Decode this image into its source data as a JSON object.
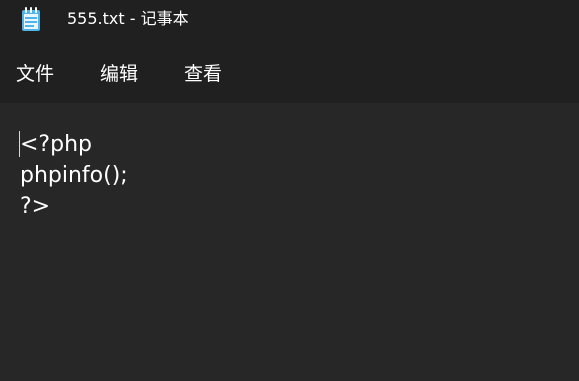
{
  "window": {
    "title": "555.txt - 记事本",
    "app_icon": "notepad-icon"
  },
  "menu": {
    "file_label": "文件",
    "edit_label": "编辑",
    "view_label": "查看"
  },
  "editor": {
    "lines": [
      "<?php",
      "phpinfo();",
      "?>"
    ]
  },
  "colors": {
    "titlebar_bg": "#202020",
    "editor_bg": "#272727",
    "text": "#ffffff",
    "icon_accent": "#4fb5e8"
  }
}
